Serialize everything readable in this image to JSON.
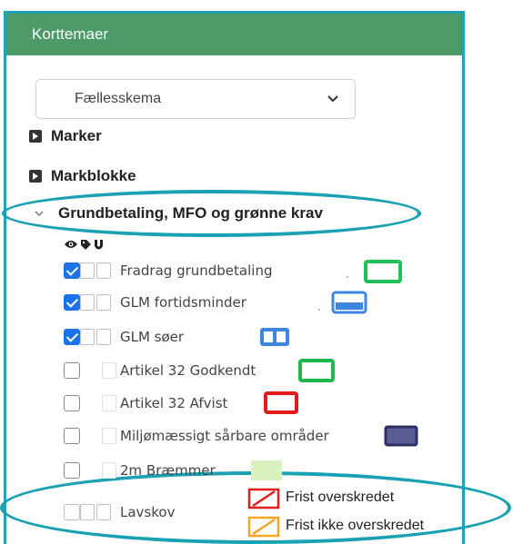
{
  "header": {
    "title": "Korttemaer"
  },
  "select": {
    "value": "Fællesskema"
  },
  "groups": [
    {
      "label": "Marker"
    },
    {
      "label": "Markblokke"
    },
    {
      "label": "Grundbetaling, MFO og grønne krav"
    }
  ],
  "layers": [
    {
      "label": "Fradrag grundbetaling",
      "checked": true,
      "swatch_color": "#1fc25a"
    },
    {
      "label": "GLM fortidsminder",
      "checked": true,
      "swatch_color": "#3d86e0"
    },
    {
      "label": "GLM søer",
      "checked": true,
      "swatch_color": "#3d86e0"
    },
    {
      "label": "Artikel 32 Godkendt",
      "checked": false,
      "swatch_color": "#1fb64b"
    },
    {
      "label": "Artikel 32 Afvist",
      "checked": false,
      "swatch_color": "#e31b1b"
    },
    {
      "label": "Miljømæssigt sårbare områder",
      "checked": false,
      "swatch_color": "#3f4384"
    },
    {
      "label": "2m Bræmmer",
      "checked": false,
      "swatch_color": "#d9f2bf"
    },
    {
      "label": "Lavskov",
      "checked": false
    }
  ],
  "legend": [
    {
      "label": "Frist overskredet",
      "color": "#e31b1b"
    },
    {
      "label": "Frist ikke overskredet",
      "color": "#f5a623"
    }
  ],
  "icons": [
    "eye-icon",
    "tag-icon",
    "magnet-icon",
    "caret-right-icon",
    "chevron-down-icon"
  ],
  "colors": {
    "header_bg": "#4b9a68",
    "frame": "#1fa3b6",
    "highlight": "#1aa2b4"
  }
}
